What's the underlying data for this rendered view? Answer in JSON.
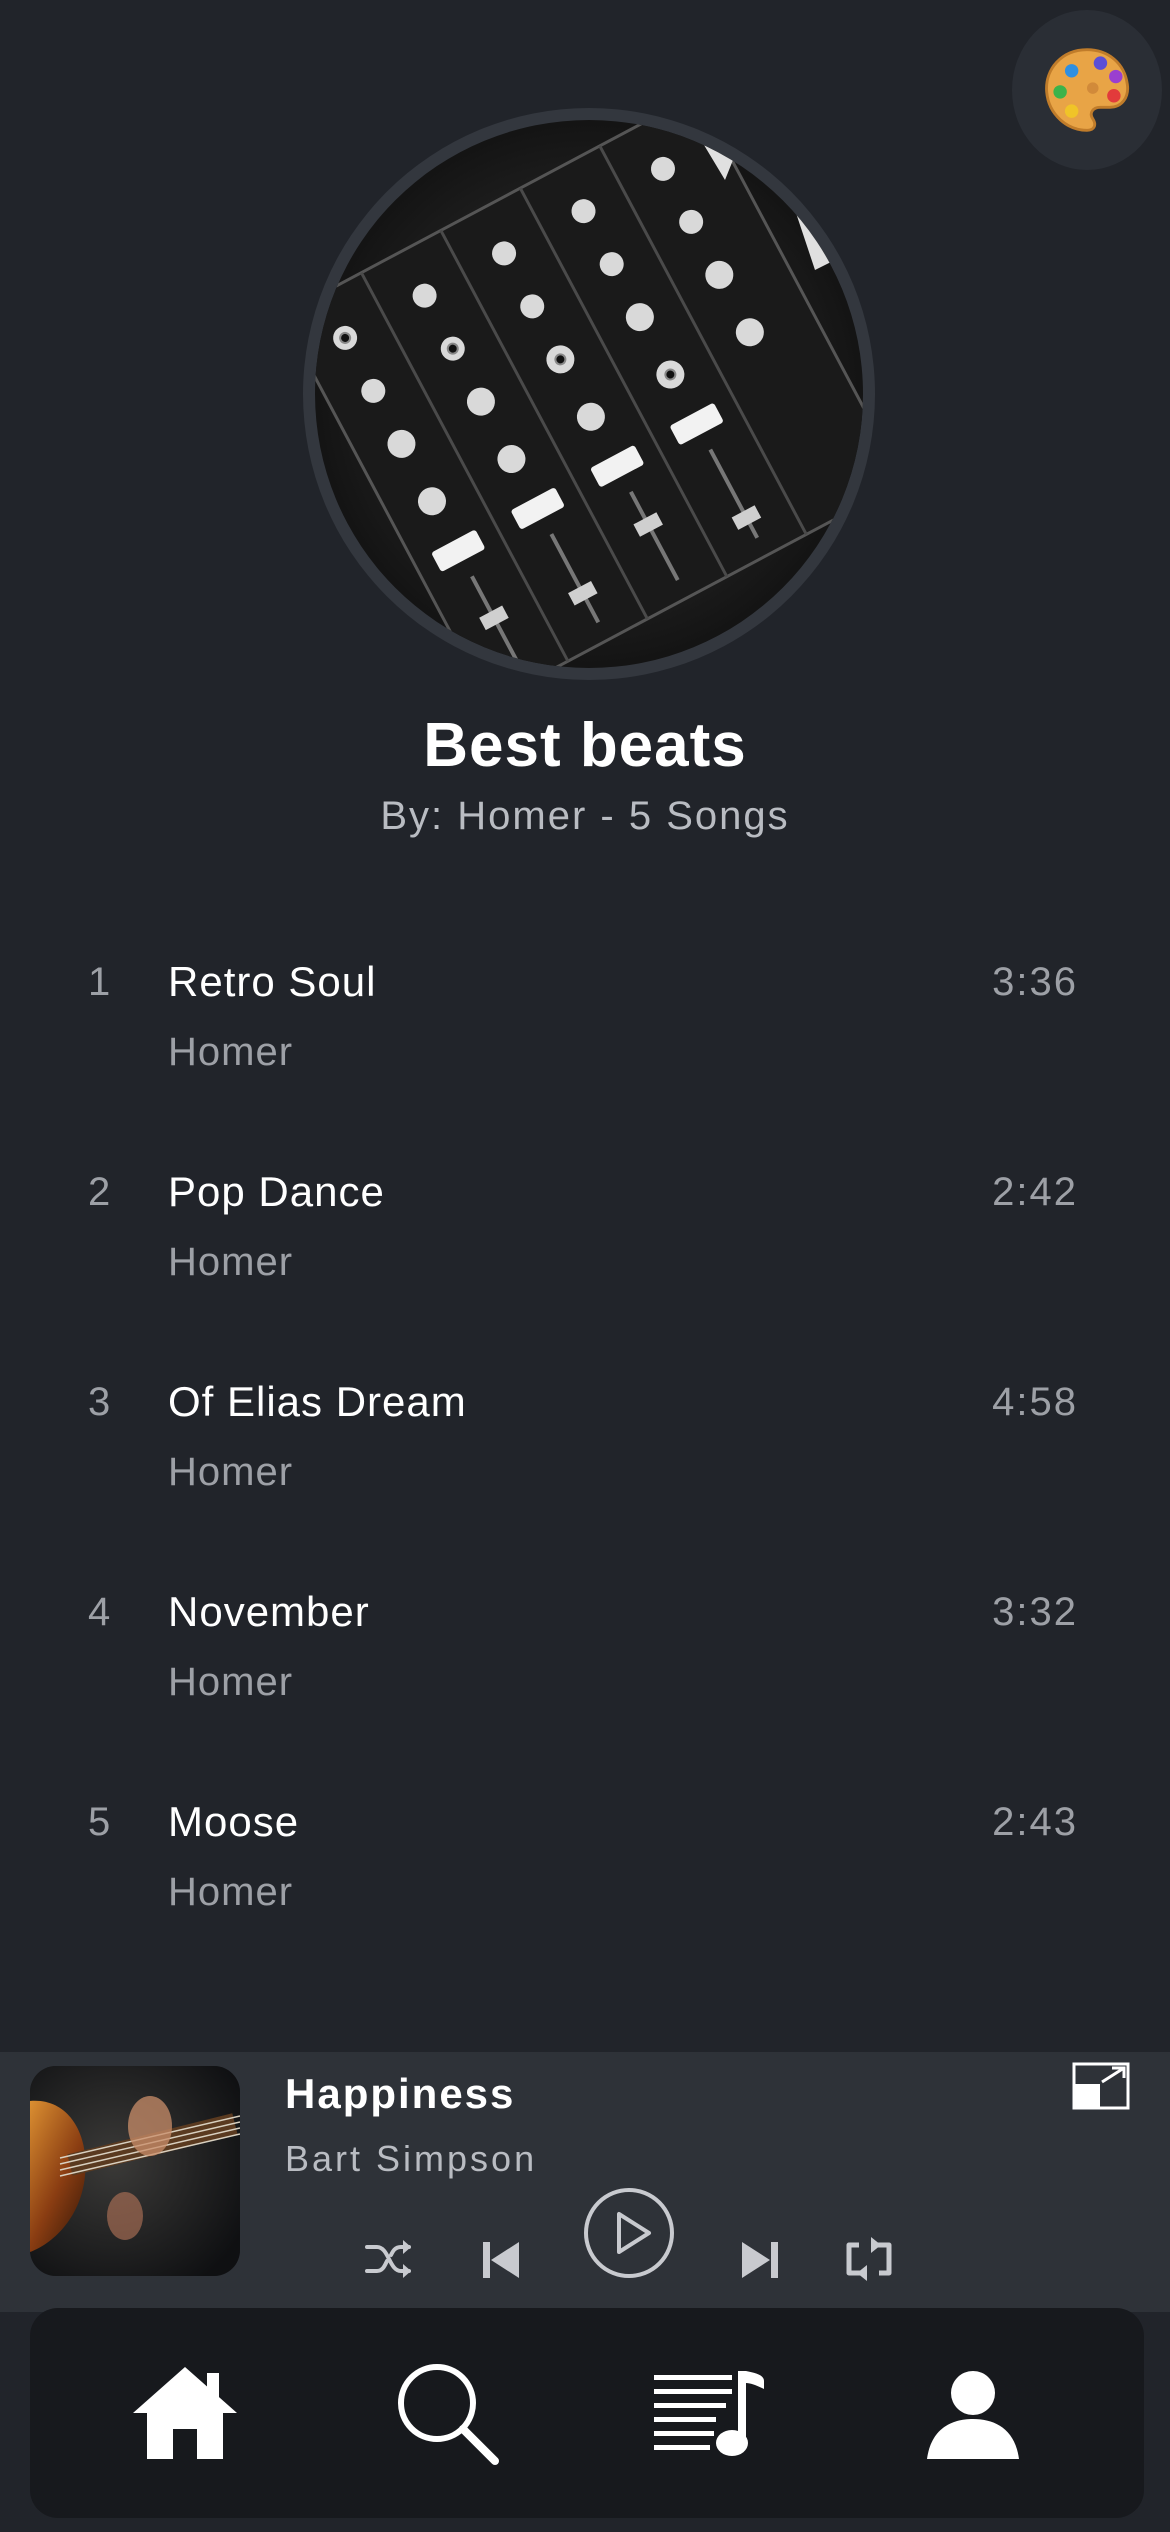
{
  "header": {
    "theme_button_icon": "palette-icon"
  },
  "playlist": {
    "cover_icon": "dj-mixer-cover-image",
    "title": "Best beats",
    "subtitle": "By: Homer - 5 Songs"
  },
  "songs": [
    {
      "number": "1",
      "title": "Retro Soul",
      "artist": "Homer",
      "duration": "3:36"
    },
    {
      "number": "2",
      "title": "Pop Dance",
      "artist": "Homer",
      "duration": "2:42"
    },
    {
      "number": "3",
      "title": "Of Elias Dream",
      "artist": "Homer",
      "duration": "4:58"
    },
    {
      "number": "4",
      "title": "November",
      "artist": "Homer",
      "duration": "3:32"
    },
    {
      "number": "5",
      "title": "Moose",
      "artist": "Homer",
      "duration": "2:43"
    }
  ],
  "player": {
    "title": "Happiness",
    "artist": "Bart Simpson",
    "art_icon": "guitar-album-art",
    "controls": [
      "shuffle-icon",
      "previous-icon",
      "play-icon",
      "next-icon",
      "repeat-icon"
    ],
    "expand_icon": "expand-icon"
  },
  "nav": {
    "tabs": [
      "home-icon",
      "search-icon",
      "playlist-icon",
      "profile-icon"
    ]
  },
  "colors": {
    "background": "#21242a",
    "player_background": "#2e3238",
    "nav_background": "#17191d",
    "primary_text": "#ffffff",
    "secondary_text": "#9da0a6"
  }
}
